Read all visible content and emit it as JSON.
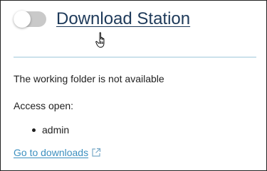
{
  "header": {
    "toggle_state": "off",
    "title": "Download Station"
  },
  "status": {
    "message": "The working folder is not available"
  },
  "access": {
    "label": "Access open:",
    "users": [
      "admin"
    ]
  },
  "footer": {
    "link_label": "Go to downloads",
    "link_icon": "external-link-icon"
  },
  "colors": {
    "title": "#1e3a5a",
    "link": "#3b8fbf",
    "divider": "#9fc8da",
    "toggle_off": "#c9c9c9"
  }
}
